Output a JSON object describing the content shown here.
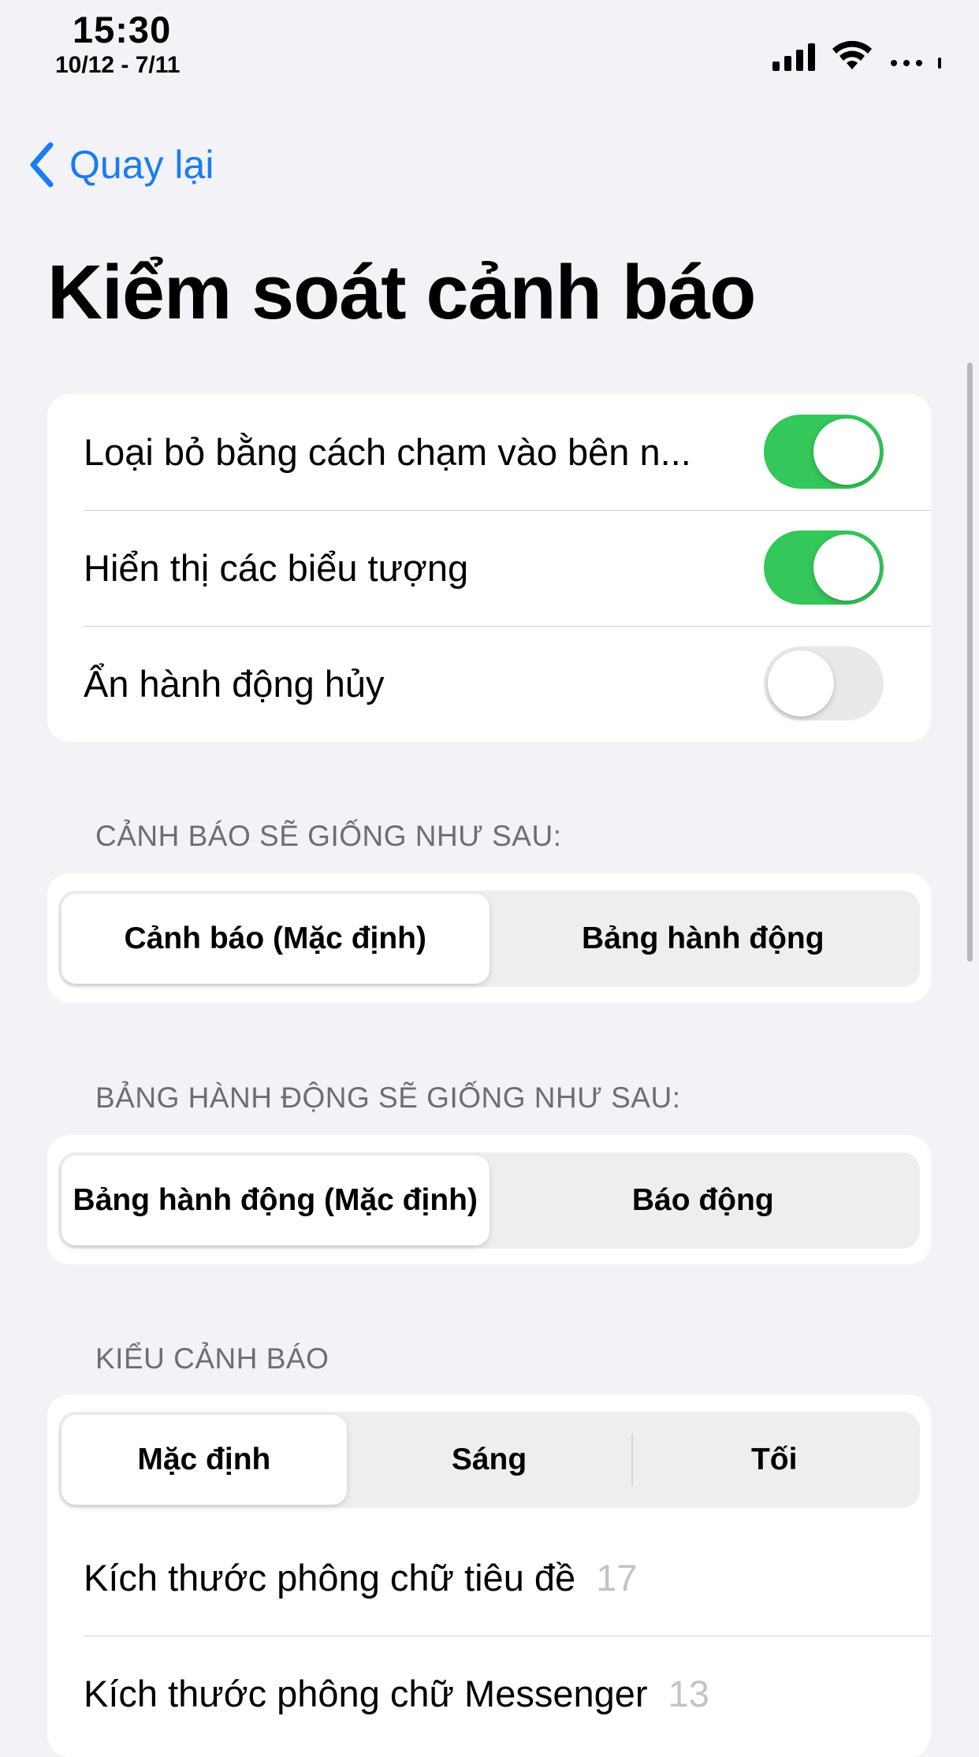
{
  "status_bar": {
    "time": "15:30",
    "date": "10/12 - 7/11"
  },
  "nav": {
    "back_label": "Quay lại"
  },
  "page": {
    "title": "Kiểm soát cảnh báo"
  },
  "toggles": [
    {
      "label": "Loại bỏ bằng cách chạm vào bên n...",
      "on": true
    },
    {
      "label": "Hiển thị các biểu tượng",
      "on": true
    },
    {
      "label": "Ẩn hành động hủy",
      "on": false
    }
  ],
  "alert_style_section": {
    "header": "CẢNH BÁO SẼ GIỐNG NHƯ SAU:",
    "options": [
      "Cảnh báo (Mặc định)",
      "Bảng hành động"
    ],
    "selected": "Cảnh báo (Mặc định)"
  },
  "action_sheet_section": {
    "header": "BẢNG HÀNH ĐỘNG SẼ GIỐNG NHƯ SAU:",
    "options": [
      "Bảng hành động (Mặc định)",
      "Báo động"
    ],
    "selected": "Bảng hành động (Mặc định)"
  },
  "theme_section": {
    "header": "KIỂU CẢNH BÁO",
    "options": [
      "Mặc định",
      "Sáng",
      "Tối"
    ],
    "selected": "Mặc định"
  },
  "font_rows": [
    {
      "label": "Kích thước phông chữ tiêu đề",
      "value": "17"
    },
    {
      "label": "Kích thước phông chữ Messenger",
      "value": "13"
    }
  ],
  "colors": {
    "accent": "#1a7cf5",
    "toggle_on": "#34c759",
    "background": "#f2f2f7"
  }
}
